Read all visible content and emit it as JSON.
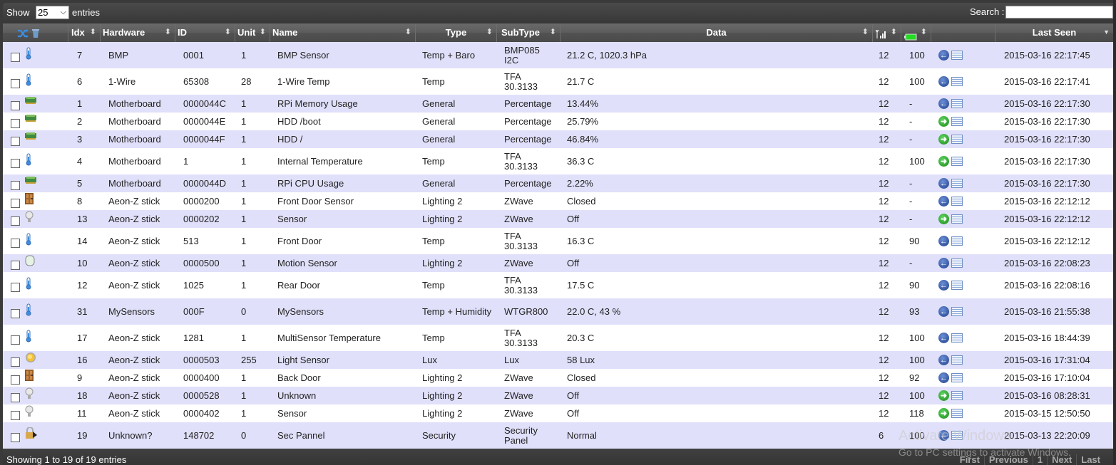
{
  "toolbar": {
    "show_label": "Show",
    "length_value": "25",
    "entries_label": "entries",
    "search_label": "Search :",
    "search_value": ""
  },
  "columns": {
    "idx": "Idx",
    "hardware": "Hardware",
    "id": "ID",
    "unit": "Unit",
    "name": "Name",
    "type": "Type",
    "subtype": "SubType",
    "data": "Data",
    "signal_icon": "signal-level-icon",
    "battery_icon": "battery-level-icon",
    "last_seen": "Last Seen",
    "select_all_icon": "shuffle-icon",
    "delete_icon": "trash-icon"
  },
  "colors": {
    "row_odd": "#e0e0fa",
    "row_even": "#ffffff",
    "header_bg": "#5c5c5c",
    "action_blue": "#1e3f8a",
    "action_green": "#1a8a1a",
    "battery_green": "#22dd22"
  },
  "rows": [
    {
      "icon": "thermometer",
      "idx": "7",
      "hardware": "BMP",
      "id": "0001",
      "unit": "1",
      "name": "BMP Sensor",
      "type": "Temp + Baro",
      "subtype": "BMP085 I2C",
      "data": "21.2 C, 1020.3 hPa",
      "signal": "12",
      "battery": "100",
      "action": "blue-left",
      "last_seen": "2015-03-16 22:17:45",
      "tall": true
    },
    {
      "icon": "thermometer",
      "idx": "6",
      "hardware": "1-Wire",
      "id": "65308",
      "unit": "28",
      "name": "1-Wire Temp",
      "type": "Temp",
      "subtype": "TFA 30.3133",
      "data": "21.7 C",
      "signal": "12",
      "battery": "100",
      "action": "blue-left",
      "last_seen": "2015-03-16 22:17:41",
      "tall": true
    },
    {
      "icon": "board",
      "idx": "1",
      "hardware": "Motherboard",
      "id": "0000044C",
      "unit": "1",
      "name": "RPi Memory Usage",
      "type": "General",
      "subtype": "Percentage",
      "data": "13.44%",
      "signal": "12",
      "battery": "-",
      "action": "blue-left",
      "last_seen": "2015-03-16 22:17:30",
      "tall": false
    },
    {
      "icon": "board",
      "idx": "2",
      "hardware": "Motherboard",
      "id": "0000044E",
      "unit": "1",
      "name": "HDD /boot",
      "type": "General",
      "subtype": "Percentage",
      "data": "25.79%",
      "signal": "12",
      "battery": "-",
      "action": "green-right",
      "last_seen": "2015-03-16 22:17:30",
      "tall": false
    },
    {
      "icon": "board",
      "idx": "3",
      "hardware": "Motherboard",
      "id": "0000044F",
      "unit": "1",
      "name": "HDD /",
      "type": "General",
      "subtype": "Percentage",
      "data": "46.84%",
      "signal": "12",
      "battery": "-",
      "action": "green-right",
      "last_seen": "2015-03-16 22:17:30",
      "tall": false
    },
    {
      "icon": "thermometer",
      "idx": "4",
      "hardware": "Motherboard",
      "id": "1",
      "unit": "1",
      "name": "Internal Temperature",
      "type": "Temp",
      "subtype": "TFA 30.3133",
      "data": "36.3 C",
      "signal": "12",
      "battery": "100",
      "action": "green-right",
      "last_seen": "2015-03-16 22:17:30",
      "tall": true
    },
    {
      "icon": "board",
      "idx": "5",
      "hardware": "Motherboard",
      "id": "0000044D",
      "unit": "1",
      "name": "RPi CPU Usage",
      "type": "General",
      "subtype": "Percentage",
      "data": "2.22%",
      "signal": "12",
      "battery": "-",
      "action": "blue-left",
      "last_seen": "2015-03-16 22:17:30",
      "tall": false
    },
    {
      "icon": "door",
      "idx": "8",
      "hardware": "Aeon-Z stick",
      "id": "0000200",
      "unit": "1",
      "name": "Front Door Sensor",
      "type": "Lighting 2",
      "subtype": "ZWave",
      "data": "Closed",
      "signal": "12",
      "battery": "-",
      "action": "blue-left",
      "last_seen": "2015-03-16 22:12:12",
      "tall": false
    },
    {
      "icon": "bulb",
      "idx": "13",
      "hardware": "Aeon-Z stick",
      "id": "0000202",
      "unit": "1",
      "name": "Sensor",
      "type": "Lighting 2",
      "subtype": "ZWave",
      "data": "Off",
      "signal": "12",
      "battery": "-",
      "action": "green-right",
      "last_seen": "2015-03-16 22:12:12",
      "tall": false
    },
    {
      "icon": "thermometer",
      "idx": "14",
      "hardware": "Aeon-Z stick",
      "id": "513",
      "unit": "1",
      "name": "Front Door",
      "type": "Temp",
      "subtype": "TFA 30.3133",
      "data": "16.3 C",
      "signal": "12",
      "battery": "90",
      "action": "blue-left",
      "last_seen": "2015-03-16 22:12:12",
      "tall": true
    },
    {
      "icon": "motion",
      "idx": "10",
      "hardware": "Aeon-Z stick",
      "id": "0000500",
      "unit": "1",
      "name": "Motion Sensor",
      "type": "Lighting 2",
      "subtype": "ZWave",
      "data": "Off",
      "signal": "12",
      "battery": "-",
      "action": "blue-left",
      "last_seen": "2015-03-16 22:08:23",
      "tall": false
    },
    {
      "icon": "thermometer",
      "idx": "12",
      "hardware": "Aeon-Z stick",
      "id": "1025",
      "unit": "1",
      "name": "Rear Door",
      "type": "Temp",
      "subtype": "TFA 30.3133",
      "data": "17.5 C",
      "signal": "12",
      "battery": "90",
      "action": "blue-left",
      "last_seen": "2015-03-16 22:08:16",
      "tall": true
    },
    {
      "icon": "thermometer",
      "idx": "31",
      "hardware": "MySensors",
      "id": "000F",
      "unit": "0",
      "name": "MySensors",
      "type": "Temp + Humidity",
      "subtype": "WTGR800",
      "data": "22.0 C, 43 %",
      "signal": "12",
      "battery": "93",
      "action": "blue-left",
      "last_seen": "2015-03-16 21:55:38",
      "tall": true
    },
    {
      "icon": "thermometer",
      "idx": "17",
      "hardware": "Aeon-Z stick",
      "id": "1281",
      "unit": "1",
      "name": "MultiSensor Temperature",
      "type": "Temp",
      "subtype": "TFA 30.3133",
      "data": "20.3 C",
      "signal": "12",
      "battery": "100",
      "action": "blue-left",
      "last_seen": "2015-03-16 18:44:39",
      "tall": true
    },
    {
      "icon": "lux",
      "idx": "16",
      "hardware": "Aeon-Z stick",
      "id": "0000503",
      "unit": "255",
      "name": "Light Sensor",
      "type": "Lux",
      "subtype": "Lux",
      "data": "58 Lux",
      "signal": "12",
      "battery": "100",
      "action": "blue-left",
      "last_seen": "2015-03-16 17:31:04",
      "tall": false
    },
    {
      "icon": "door",
      "idx": "9",
      "hardware": "Aeon-Z stick",
      "id": "0000400",
      "unit": "1",
      "name": "Back Door",
      "type": "Lighting 2",
      "subtype": "ZWave",
      "data": "Closed",
      "signal": "12",
      "battery": "92",
      "action": "blue-left",
      "last_seen": "2015-03-16 17:10:04",
      "tall": false
    },
    {
      "icon": "bulb",
      "idx": "18",
      "hardware": "Aeon-Z stick",
      "id": "0000528",
      "unit": "1",
      "name": "Unknown",
      "type": "Lighting 2",
      "subtype": "ZWave",
      "data": "Off",
      "signal": "12",
      "battery": "100",
      "action": "green-right",
      "last_seen": "2015-03-16 08:28:31",
      "tall": false
    },
    {
      "icon": "bulb",
      "idx": "11",
      "hardware": "Aeon-Z stick",
      "id": "0000402",
      "unit": "1",
      "name": "Sensor",
      "type": "Lighting 2",
      "subtype": "ZWave",
      "data": "Off",
      "signal": "12",
      "battery": "118",
      "action": "green-right",
      "last_seen": "2015-03-15 12:50:50",
      "tall": false
    },
    {
      "icon": "security",
      "idx": "19",
      "hardware": "Unknown?",
      "id": "148702",
      "unit": "0",
      "name": "Sec Pannel",
      "type": "Security",
      "subtype": "Security Panel",
      "data": "Normal",
      "signal": "6",
      "battery": "100",
      "action": "blue-left",
      "last_seen": "2015-03-13 22:20:09",
      "tall": true
    }
  ],
  "footer": {
    "info": "Showing 1 to 19 of 19 entries",
    "pager": [
      "First",
      "Previous",
      "1",
      "Next",
      "Last"
    ]
  },
  "watermark": {
    "line1": "Activate Windows",
    "line2": "Go to PC settings to activate Windows."
  }
}
